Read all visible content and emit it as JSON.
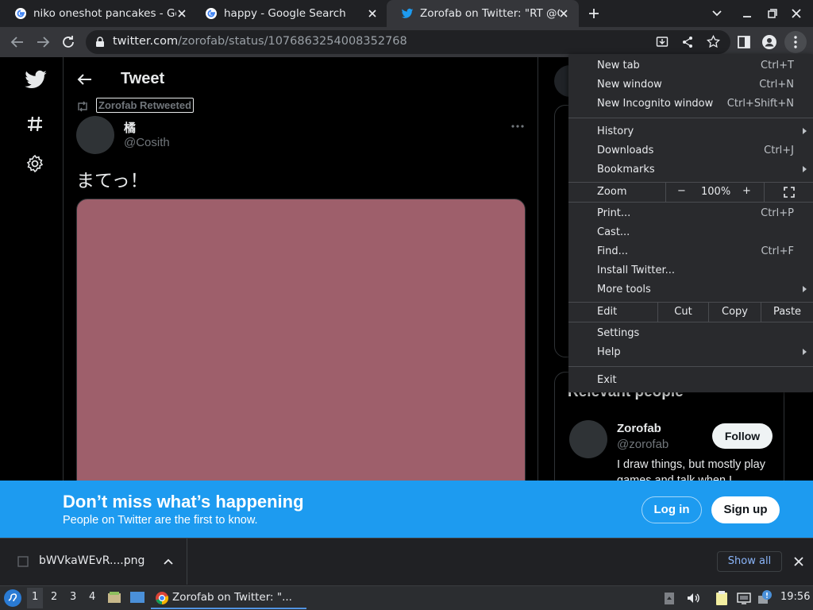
{
  "tabs": [
    {
      "title": "niko oneshot pancakes - Google Search",
      "favicon": "google-icon"
    },
    {
      "title": "happy - Google Search",
      "favicon": "google-icon"
    },
    {
      "title": "Zorofab on Twitter: \"RT @Cosith",
      "favicon": "twitter-icon"
    }
  ],
  "address": {
    "host": "twitter.com",
    "path": "/zorofab/status/1076863254008352768"
  },
  "tweet": {
    "header_title": "Tweet",
    "retweeted_by": "Zorofab Retweeted",
    "author_name": "橘",
    "author_handle": "@Cosith",
    "text": "まてっ！",
    "media_color": "#9e5f6b"
  },
  "sidebar": {
    "relevant_title": "Relevant people",
    "person_name": "Zorofab",
    "person_handle": "@zorofab",
    "follow_label": "Follow",
    "bio": "I draw things, but mostly play games and talk when I"
  },
  "banner": {
    "title": "Don’t miss what’s happening",
    "subtitle": "People on Twitter are the first to know.",
    "login_label": "Log in",
    "signup_label": "Sign up",
    "color": "#1d9bf0"
  },
  "menu": {
    "new_tab": "New tab",
    "new_tab_sc": "Ctrl+T",
    "new_window": "New window",
    "new_window_sc": "Ctrl+N",
    "incognito": "New Incognito window",
    "incognito_sc": "Ctrl+Shift+N",
    "history": "History",
    "downloads": "Downloads",
    "downloads_sc": "Ctrl+J",
    "bookmarks": "Bookmarks",
    "zoom": "Zoom",
    "zoom_minus": "−",
    "zoom_value": "100%",
    "zoom_plus": "+",
    "print": "Print...",
    "print_sc": "Ctrl+P",
    "cast": "Cast...",
    "find": "Find...",
    "find_sc": "Ctrl+F",
    "install": "Install Twitter...",
    "more_tools": "More tools",
    "edit": "Edit",
    "cut": "Cut",
    "copy": "Copy",
    "paste": "Paste",
    "settings": "Settings",
    "help": "Help",
    "exit": "Exit"
  },
  "download": {
    "filename": "bWVkaWEvR....png",
    "show_all": "Show all"
  },
  "taskbar": {
    "workspaces": [
      "1",
      "2",
      "3",
      "4"
    ],
    "window_title": "Zorofab on Twitter: \"...",
    "clock": "19:56"
  }
}
